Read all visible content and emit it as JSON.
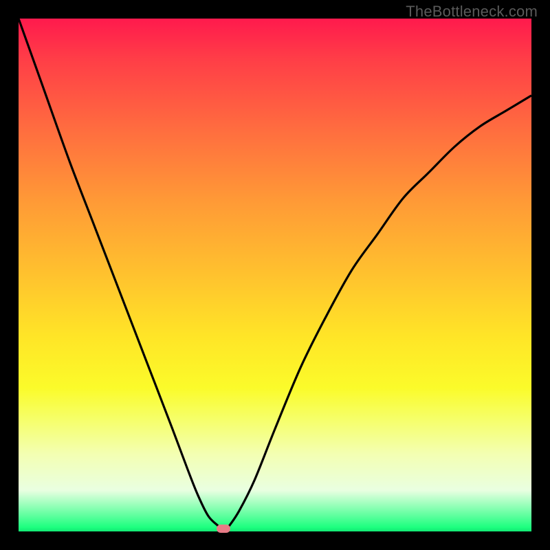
{
  "watermark": "TheBottleneck.com",
  "chart_data": {
    "type": "line",
    "title": "",
    "xlabel": "",
    "ylabel": "",
    "xlim": [
      0,
      100
    ],
    "ylim": [
      0,
      100
    ],
    "grid": false,
    "series": [
      {
        "name": "bottleneck-curve",
        "x": [
          0,
          5,
          10,
          15,
          20,
          25,
          30,
          33,
          35,
          37,
          39,
          40,
          41,
          43,
          46,
          50,
          55,
          60,
          65,
          70,
          75,
          80,
          85,
          90,
          95,
          100
        ],
        "values": [
          100,
          86,
          72,
          59,
          46,
          33,
          20,
          12,
          7,
          3,
          1,
          0,
          1,
          4,
          10,
          20,
          32,
          42,
          51,
          58,
          65,
          70,
          75,
          79,
          82,
          85
        ]
      }
    ],
    "annotations": [
      {
        "name": "min-marker",
        "x": 40,
        "y": 0,
        "color": "#e87b86"
      }
    ],
    "gradient_stops": [
      {
        "pos": 0,
        "color": "#ff1a4d"
      },
      {
        "pos": 0.5,
        "color": "#ffc22e"
      },
      {
        "pos": 0.78,
        "color": "#f6ff68"
      },
      {
        "pos": 0.99,
        "color": "#1dff7f"
      },
      {
        "pos": 1.0,
        "color": "#12e874"
      }
    ]
  }
}
